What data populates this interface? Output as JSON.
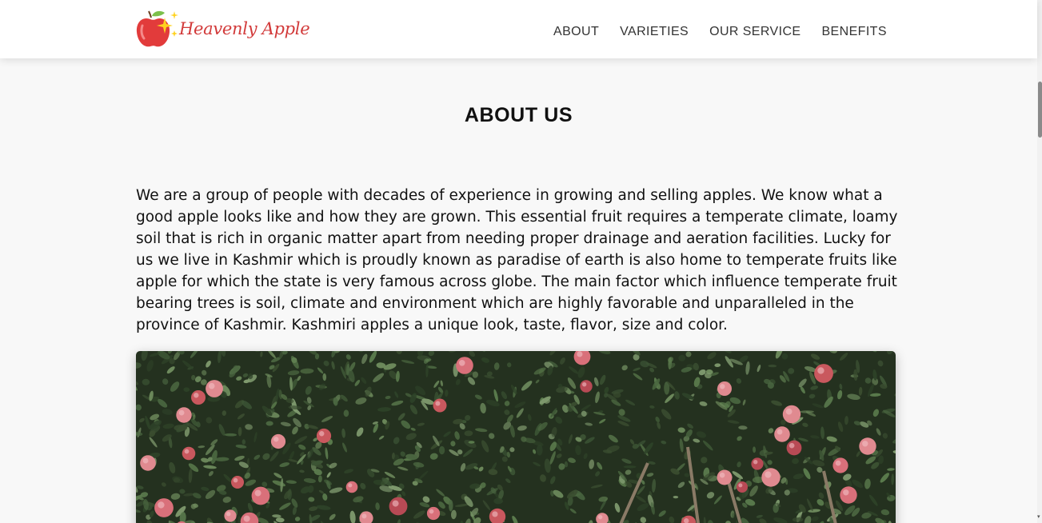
{
  "header": {
    "brand_name": "Heavenly Apple",
    "logo_icon": "apple-sparkle-icon",
    "nav": [
      {
        "label": "ABOUT"
      },
      {
        "label": "VARIETIES"
      },
      {
        "label": "OUR SERVICE"
      },
      {
        "label": "BENEFITS"
      }
    ]
  },
  "about": {
    "title": "ABOUT US",
    "paragraph": "We are a group of people with decades of experience in growing and selling apples. We know what a good apple looks like and how they are grown. This essential fruit requires a temperate climate, loamy soil that is rich in organic matter apart from needing proper drainage and aeration facilities. Lucky for us we live in Kashmir which is proudly known as paradise of earth is also home to temperate fruits like apple for which the state is very famous across globe. The main factor which influence temperate fruit bearing trees is soil, climate and environment which are highly favorable and unparalleled in the province of Kashmir. Kashmiri apples a unique look, taste, flavor, size and color."
  },
  "colors": {
    "brand_red": "#d23a3a",
    "foliage_dark": "#24311f",
    "apple_red": "#c9585e"
  }
}
